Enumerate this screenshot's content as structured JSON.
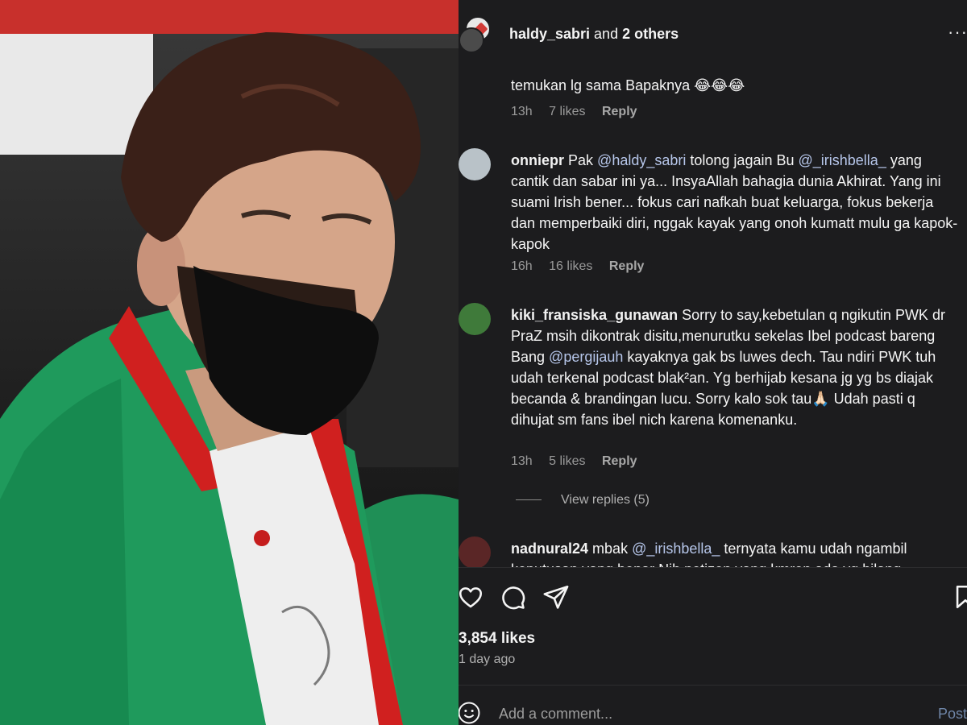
{
  "header": {
    "username": "haldy_sabri",
    "and_text": " and ",
    "others": "2 others"
  },
  "previous_comment": {
    "text": "temukan lg sama Bapaknya 😂😂😂",
    "time": "13h",
    "likes": "7 likes",
    "reply": "Reply"
  },
  "comments": [
    {
      "user": "onniepr",
      "segments": [
        "Pak ",
        "@haldy_sabri",
        " tolong jagain Bu ",
        "@_irishbella_",
        " yang cantik dan sabar ini ya... InsyaAllah bahagia dunia Akhirat. Yang ini suami Irish bener... fokus cari nafkah buat keluarga, fokus bekerja dan memperbaiki diri, nggak kayak yang onoh kumatt mulu ga kapok-kapok"
      ],
      "time": "16h",
      "likes": "16 likes",
      "reply": "Reply"
    },
    {
      "user": "kiki_fransiska_gunawan",
      "segments": [
        "Sorry to say,kebetulan q ngikutin PWK dr PraZ msih dikontrak disitu,menurutku sekelas Ibel podcast bareng Bang ",
        "@pergijauh",
        " kayaknya gak bs luwes dech. Tau ndiri PWK tuh udah terkenal podcast blak²an. Yg berhijab kesana jg yg bs diajak becanda & brandingan lucu. Sorry kalo sok tau🙏🏻 Udah pasti q dihujat sm fans ibel nich karena komenanku."
      ],
      "time": "13h",
      "likes": "5 likes",
      "reply": "Reply"
    },
    {
      "user": "nadnural24",
      "segments": [
        "mbak ",
        "@_irishbella_",
        " ternyata kamu udah ngambil keputusan yang benar Nih netizen yang kmren ada yg bilang"
      ]
    }
  ],
  "view_replies": "View replies (5)",
  "post": {
    "likes": "3,854 likes",
    "time_ago": "1 day ago"
  },
  "add_comment": {
    "placeholder": "Add a comment...",
    "post_label": "Post"
  },
  "icons": {
    "like": "heart-icon",
    "comment": "comment-icon",
    "share": "send-icon",
    "save": "bookmark-icon",
    "emoji": "emoji-icon",
    "more": "more-icon"
  },
  "colors": {
    "background": "#1c1c1e",
    "mention": "#b6c6ea",
    "muted": "#9a9a9a"
  }
}
